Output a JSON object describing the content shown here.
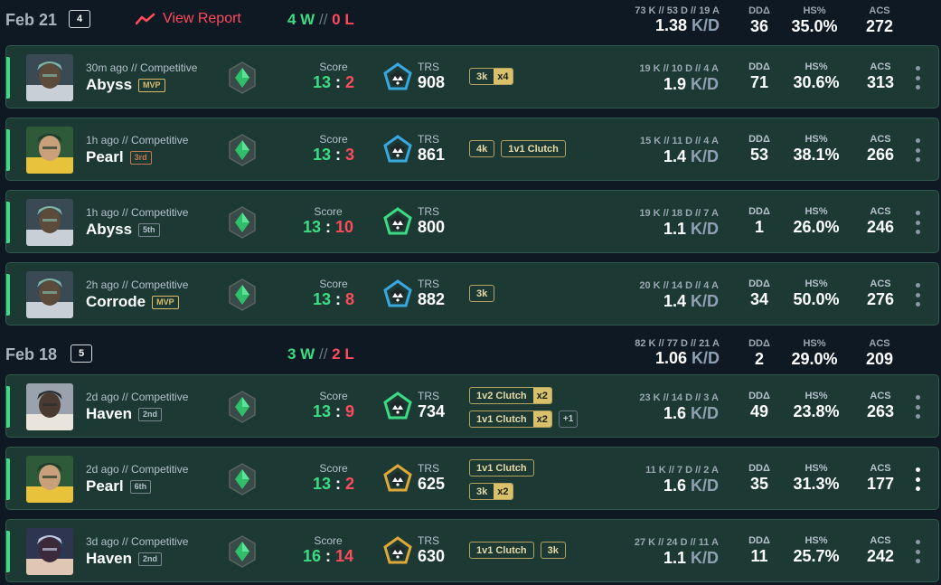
{
  "groups": [
    {
      "date": "Feb 21",
      "count": "4",
      "view_report": "View Report",
      "wins": "4 W",
      "sep": "//",
      "losses": "0 L",
      "kda": "73 K // 53 D // 19 A",
      "kd": "1.38",
      "kd_unit": "K/D",
      "ddd_label": "DDΔ",
      "ddd": "36",
      "hs_label": "HS%",
      "hs": "35.0%",
      "acs_label": "ACS",
      "acs": "272"
    },
    {
      "date": "Feb 18",
      "count": "5",
      "wins": "3 W",
      "sep": "//",
      "losses": "2 L",
      "kda": "82 K // 77 D // 21 A",
      "kd": "1.06",
      "kd_unit": "K/D",
      "ddd_label": "DDΔ",
      "ddd": "2",
      "hs_label": "HS%",
      "hs": "29.0%",
      "acs_label": "ACS",
      "acs": "209"
    }
  ],
  "labels": {
    "score": "Score",
    "trs": "TRS",
    "ddd": "DDΔ",
    "hs": "HS%",
    "acs": "ACS",
    "kd_unit": "K/D",
    "colon": ":"
  },
  "matches": [
    {
      "agent": "agent-portrait-1",
      "meta": "30m ago // Competitive",
      "map": "Abyss",
      "place": "MVP",
      "score_w": "13",
      "score_l": "2",
      "trs_color": "#3aa8e0",
      "trs": "908",
      "badges": [
        [
          "3k",
          "x4"
        ]
      ],
      "badges2": [],
      "kda": "19 K // 10 D // 4 A",
      "kd": "1.9",
      "ddd": "71",
      "hs": "30.6%",
      "acs": "313"
    },
    {
      "agent": "agent-portrait-2",
      "meta": "1h ago // Competitive",
      "map": "Pearl",
      "place": "3rd",
      "score_w": "13",
      "score_l": "3",
      "trs_color": "#3aa8e0",
      "trs": "861",
      "badges": [
        [
          "4k",
          ""
        ],
        [
          "1v1 Clutch",
          ""
        ]
      ],
      "badges2": [],
      "kda": "15 K // 11 D // 4 A",
      "kd": "1.4",
      "ddd": "53",
      "hs": "38.1%",
      "acs": "266"
    },
    {
      "agent": "agent-portrait-1",
      "meta": "1h ago // Competitive",
      "map": "Abyss",
      "place": "5th",
      "score_w": "13",
      "score_l": "10",
      "trs_color": "#3ddc84",
      "trs": "800",
      "badges": [],
      "badges2": [],
      "kda": "19 K // 18 D // 7 A",
      "kd": "1.1",
      "ddd": "1",
      "hs": "26.0%",
      "acs": "246"
    },
    {
      "agent": "agent-portrait-1",
      "meta": "2h ago // Competitive",
      "map": "Corrode",
      "place": "MVP",
      "score_w": "13",
      "score_l": "8",
      "trs_color": "#3aa8e0",
      "trs": "882",
      "badges": [
        [
          "3k",
          ""
        ]
      ],
      "badges2": [],
      "kda": "20 K // 14 D // 4 A",
      "kd": "1.4",
      "ddd": "34",
      "hs": "50.0%",
      "acs": "276"
    },
    {
      "agent": "agent-portrait-3",
      "meta": "2d ago // Competitive",
      "map": "Haven",
      "place": "2nd",
      "score_w": "13",
      "score_l": "9",
      "trs_color": "#3ddc84",
      "trs": "734",
      "badges": [
        [
          "1v2 Clutch",
          "x2"
        ]
      ],
      "badges2": [
        [
          "1v1 Clutch",
          "x2"
        ]
      ],
      "plus": "+1",
      "kda": "23 K // 14 D // 3 A",
      "kd": "1.6",
      "ddd": "49",
      "hs": "23.8%",
      "acs": "263"
    },
    {
      "agent": "agent-portrait-2",
      "meta": "2d ago // Competitive",
      "map": "Pearl",
      "place": "6th",
      "score_w": "13",
      "score_l": "2",
      "trs_color": "#e0a83a",
      "trs": "625",
      "badges": [
        [
          "1v1 Clutch",
          ""
        ]
      ],
      "badges2": [
        [
          "3k",
          "x2"
        ]
      ],
      "kda": "11 K // 7 D // 2 A",
      "kd": "1.6",
      "ddd": "35",
      "hs": "31.3%",
      "acs": "177"
    },
    {
      "agent": "agent-portrait-4",
      "meta": "3d ago // Competitive",
      "map": "Haven",
      "place": "2nd",
      "score_w": "16",
      "score_l": "14",
      "trs_color": "#e0a83a",
      "trs": "630",
      "badges": [
        [
          "1v1 Clutch",
          ""
        ],
        [
          "3k",
          ""
        ]
      ],
      "badges2": [],
      "kda": "27 K // 24 D // 11 A",
      "kd": "1.1",
      "ddd": "11",
      "hs": "25.7%",
      "acs": "242"
    }
  ],
  "colors": {
    "win": "#3ddc84",
    "loss": "#ff4b5c",
    "card": "#1c3a33",
    "bg": "#0f1923"
  }
}
